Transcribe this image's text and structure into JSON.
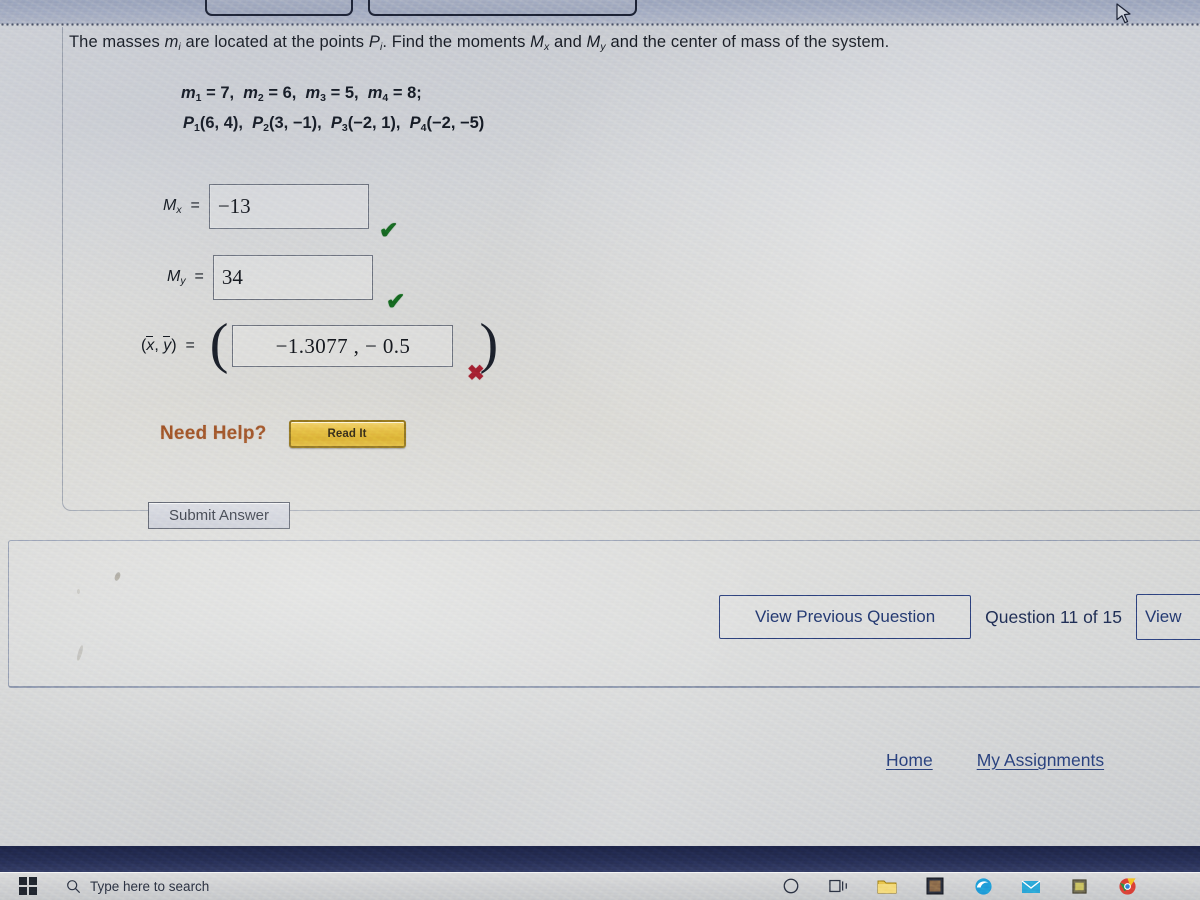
{
  "browser": {
    "tab_1": "",
    "tab_2": ""
  },
  "question": {
    "prompt_part_1": "The masses ",
    "prompt_m": "m",
    "prompt_m_sub": "i",
    "prompt_part_2": " are located at the points ",
    "prompt_p": "P",
    "prompt_p_sub": "i",
    "prompt_part_3": ". Find the moments ",
    "prompt_mx": "M",
    "prompt_mx_sub": "x",
    "prompt_part_4": " and ",
    "prompt_my": "M",
    "prompt_my_sub": "y",
    "prompt_part_5": " and the center of mass of the system.",
    "givens_line_1": "m1 = 7,  m2 = 6,  m3 = 5,  m4 = 8;",
    "givens_line_2": "P1(6, 4),  P2(3, −1),  P3(−2, 1),  P4(−2, −5)",
    "masses": [
      {
        "name": "m",
        "index": "1",
        "value": "7"
      },
      {
        "name": "m",
        "index": "2",
        "value": "6"
      },
      {
        "name": "m",
        "index": "3",
        "value": "5"
      },
      {
        "name": "m",
        "index": "4",
        "value": "8"
      }
    ],
    "points": [
      {
        "name": "P",
        "index": "1",
        "coords": "(6, 4)"
      },
      {
        "name": "P",
        "index": "2",
        "coords": "(3, −1)"
      },
      {
        "name": "P",
        "index": "3",
        "coords": "(−2, 1)"
      },
      {
        "name": "P",
        "index": "4",
        "coords": "(−2, −5)"
      }
    ]
  },
  "answers": {
    "mx": {
      "label_main": "M",
      "label_sub": "x",
      "equals": "=",
      "value": "−13",
      "status": "correct",
      "status_glyph": "✔"
    },
    "my": {
      "label_main": "M",
      "label_sub": "y",
      "equals": "=",
      "value": "34",
      "status": "correct",
      "status_glyph": "✔"
    },
    "center_of_mass": {
      "label_x": "x",
      "label_y": "y",
      "label_comma": ",",
      "label_open": "(",
      "label_close": ")",
      "equals": "=",
      "paren_open": "(",
      "paren_close": ")",
      "value": "−1.3077 ,  − 0.5",
      "status": "incorrect",
      "status_glyph": "✖"
    }
  },
  "help": {
    "need_help_label": "Need Help?",
    "read_it_label": "Read It"
  },
  "actions": {
    "submit_label": "Submit Answer"
  },
  "navigation": {
    "previous_label": "View Previous Question",
    "counter_label": "Question 11 of 15",
    "next_label": "View"
  },
  "footer": {
    "links": [
      {
        "label": "Home"
      },
      {
        "label": "My Assignments"
      }
    ]
  },
  "taskbar": {
    "search_placeholder": "Type here to search",
    "icons": [
      "start-icon",
      "search-icon",
      "cortana-icon",
      "task-view-icon",
      "file-explorer-icon",
      "window-icon",
      "edge-icon",
      "mail-icon",
      "store-icon",
      "chrome-icon"
    ]
  },
  "colors": {
    "correct_green": "#14661f",
    "incorrect_red": "#a32030",
    "need_help_orange": "#9a4a1c",
    "link_blue": "#29407b",
    "nav_button_blue": "#2b3f7a",
    "read_it_gold": "#e3b936",
    "panel_background": "#d2d3d2"
  }
}
